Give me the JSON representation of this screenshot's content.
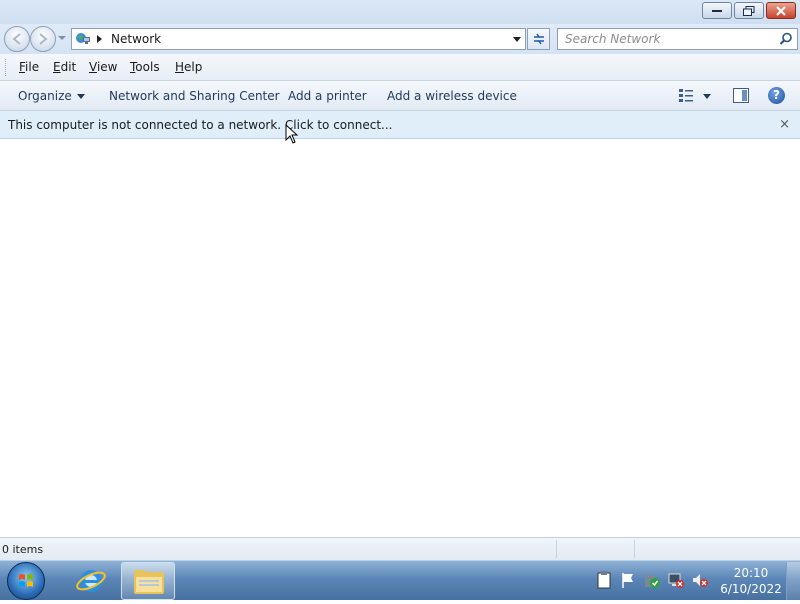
{
  "window": {
    "controls": {
      "minimize": "minimize",
      "restore": "restore",
      "close": "close"
    }
  },
  "address": {
    "location": "Network",
    "search_placeholder": "Search Network"
  },
  "menu": {
    "items": [
      {
        "access": "F",
        "rest": "ile"
      },
      {
        "access": "E",
        "rest": "dit"
      },
      {
        "access": "V",
        "rest": "iew"
      },
      {
        "access": "T",
        "rest": "ools"
      },
      {
        "access": "H",
        "rest": "elp"
      }
    ]
  },
  "commands": {
    "organize": "Organize",
    "network_center": "Network and Sharing Center",
    "add_printer": "Add a printer",
    "add_wireless": "Add a wireless device"
  },
  "infobar": {
    "message": "This computer is not connected to a network. Click to connect...",
    "close": "×"
  },
  "status": {
    "items_count": "0 items"
  },
  "taskbar": {
    "time": "20:10",
    "date": "6/10/2022"
  },
  "icons": {
    "back": "back-arrow-icon",
    "forward": "forward-arrow-icon",
    "location": "network-icon",
    "search": "search-icon",
    "help": "help-icon"
  }
}
